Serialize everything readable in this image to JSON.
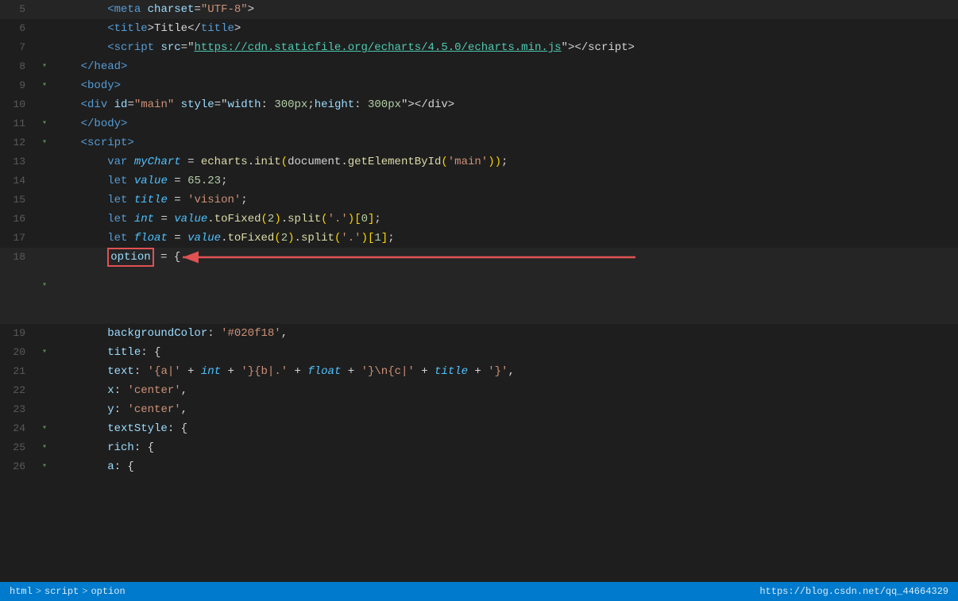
{
  "editor": {
    "background": "#1e1e1e",
    "lines": [
      {
        "num": "5",
        "fold": "",
        "content_html": "        <span class='tag'>&lt;meta</span> <span class='attr-name'>charset</span>=<span class='attr-value'>\"UTF-8\"</span><span class='plain'>&gt;</span>"
      },
      {
        "num": "6",
        "fold": "",
        "content_html": "        <span class='tag'>&lt;title</span><span class='plain'>&gt;</span><span class='plain'>Title</span><span class='plain'>&lt;/</span><span class='tag'>title</span><span class='plain'>&gt;</span>"
      },
      {
        "num": "7",
        "fold": "",
        "content_html": "        <span class='tag'>&lt;script</span> <span class='attr-name'>src</span>=<span class='plain'>\"</span><span class='url-highlight'>https://cdn.staticfile.org/echarts/4.5.0/echarts.min.js</span><span class='plain'>\"&gt;&lt;/script&gt;</span>"
      },
      {
        "num": "8",
        "fold": "▾",
        "content_html": "    <span class='tag'>&lt;/head&gt;</span>"
      },
      {
        "num": "9",
        "fold": "▾",
        "content_html": "    <span class='tag'>&lt;body&gt;</span>"
      },
      {
        "num": "10",
        "fold": "",
        "content_html": "    <span class='tag'>&lt;div</span> <span class='attr-name'>id</span>=<span class='attr-value'>\"main\"</span> <span class='attr-name'>style</span>=<span class='plain'>\"</span><span class='attr-name'>width</span><span class='plain'>: </span><span class='num'>300px</span><span class='plain'>;</span><span class='attr-name'>height</span><span class='plain'>: </span><span class='num'>300px</span><span class='plain'>\"&gt;&lt;/div&gt;</span>"
      },
      {
        "num": "11",
        "fold": "▾",
        "content_html": "    <span class='tag'>&lt;/body&gt;</span>"
      },
      {
        "num": "12",
        "fold": "▾",
        "content_html": "    <span class='tag'>&lt;script&gt;</span>"
      },
      {
        "num": "13",
        "fold": "",
        "content_html": "        <span class='keyword'>var</span> <span class='italic-var'>myChart</span> <span class='plain'>=</span> <span class='method'>echarts</span><span class='plain'>.</span><span class='method'>init</span><span class='paren'>(</span><span class='plain'>document</span><span class='plain'>.</span><span class='method'>getElementById</span><span class='paren'>(</span><span class='string-single'>'main'</span><span class='paren'>))</span><span class='plain'>;</span>"
      },
      {
        "num": "14",
        "fold": "",
        "content_html": "        <span class='keyword'>let</span> <span class='italic-var'>value</span> <span class='plain'>=</span> <span class='num'>65.23</span><span class='plain'>;</span>"
      },
      {
        "num": "15",
        "fold": "",
        "content_html": "        <span class='keyword'>let</span> <span class='italic-var'>title</span> <span class='plain'>=</span> <span class='string-single'>'vision'</span><span class='plain'>;</span>"
      },
      {
        "num": "16",
        "fold": "",
        "content_html": "        <span class='keyword'>let</span> <span class='italic-var'>int</span> <span class='plain'>=</span> <span class='italic-var'>value</span><span class='plain'>.</span><span class='method'>toFixed</span><span class='paren'>(</span><span class='num'>2</span><span class='paren'>)</span><span class='plain'>.</span><span class='method'>split</span><span class='paren'>(</span><span class='string-single'>'.'</span><span class='paren'>)</span><span class='bracket'>[</span><span class='num'>0</span><span class='bracket'>]</span><span class='plain'>;</span>"
      },
      {
        "num": "17",
        "fold": "",
        "content_html": "        <span class='keyword'>let</span> <span class='italic-var'>float</span> <span class='plain'>=</span> <span class='italic-var'>value</span><span class='plain'>.</span><span class='method'>toFixed</span><span class='paren'>(</span><span class='num'>2</span><span class='paren'>)</span><span class='plain'>.</span><span class='method'>split</span><span class='paren'>(</span><span class='string-single'>'.'</span><span class='paren'>)</span><span class='bracket'>[</span><span class='num'>1</span><span class='bracket'>]</span><span class='plain'>;</span>"
      },
      {
        "num": "18",
        "fold": "▾",
        "content_html": "        <span class='option-box'>option</span> <span class='plain'>= {</span>",
        "is_option": true
      },
      {
        "num": "19",
        "fold": "",
        "content_html": "        <span class='plain'>backgroundColor: </span><span class='string-single'>'<span class=\"hex-color\">#020f18</span>'</span><span class='plain'>,</span>"
      },
      {
        "num": "20",
        "fold": "▾",
        "content_html": "        <span class='prop'>title</span><span class='plain'>: {</span>"
      },
      {
        "num": "21",
        "fold": "",
        "content_html": "        <span class='prop'>text</span><span class='plain'>: </span><span class='string-single'>'{a|' + <span class='italic-var'>int</span> + '}{b|.' + <span class='italic-var'>float</span> + '}\\n{c|' + <span class='italic-var'>title</span> + '}'</span><span class='plain'>,</span>"
      },
      {
        "num": "22",
        "fold": "",
        "content_html": "        <span class='prop'>x</span><span class='plain'>: </span><span class='string-single'>'center'</span><span class='plain'>,</span>"
      },
      {
        "num": "23",
        "fold": "",
        "content_html": "        <span class='prop'>y</span><span class='plain'>: </span><span class='string-single'>'center'</span><span class='plain'>,</span>"
      },
      {
        "num": "24",
        "fold": "▾",
        "content_html": "        <span class='prop'>textStyle</span><span class='plain'>: {</span>"
      },
      {
        "num": "25",
        "fold": "▾",
        "content_html": "        <span class='prop'>rich</span><span class='plain'>: {</span>"
      },
      {
        "num": "26",
        "fold": "▾",
        "content_html": "        <span class='prop'>a</span><span class='plain'>: {</span>"
      }
    ],
    "breadcrumb": {
      "items": [
        "html",
        "script",
        "option"
      ]
    },
    "status_right": "https://blog.csdn.net/qq_44664329"
  }
}
